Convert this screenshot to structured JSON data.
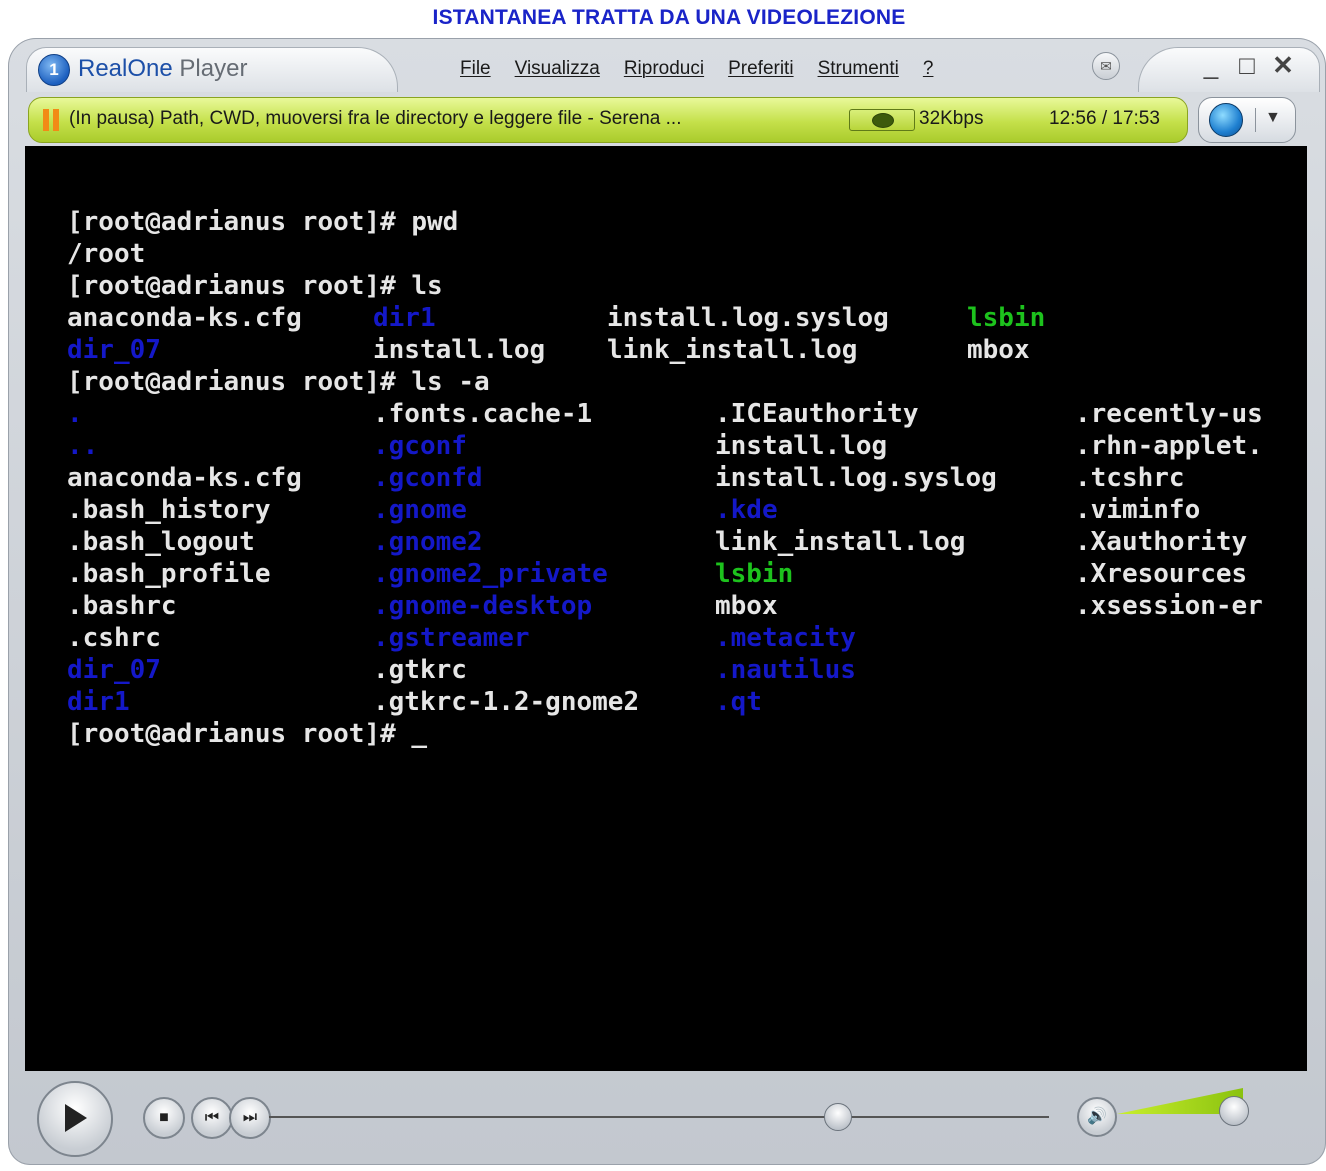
{
  "caption": "ISTANTANEA TRATTA DA UNA VIDEOLEZIONE",
  "app": {
    "logo_glyph": "1",
    "brand_name": "RealOne",
    "brand_suffix": "Player"
  },
  "menu": [
    "File",
    "Visualizza",
    "Riproduci",
    "Preferiti",
    "Strumenti",
    "?"
  ],
  "window_controls": {
    "minimize": "_",
    "maximize": "□",
    "close": "✕"
  },
  "status": {
    "clip_title": "(In pausa) Path, CWD, muoversi fra le directory e leggere file - Serena ...",
    "bitrate": "32Kbps",
    "time": "12:56 / 17:53"
  },
  "terminal": {
    "lines": [
      [
        {
          "t": "[root@adrianus root]# pwd",
          "c": "white",
          "col": 0
        }
      ],
      [
        {
          "t": "/root",
          "c": "white",
          "col": 0
        }
      ],
      [
        {
          "t": "[root@adrianus root]# ls",
          "c": "white",
          "col": 0
        }
      ],
      [
        {
          "t": "anaconda-ks.cfg",
          "c": "white",
          "col": 0
        },
        {
          "t": "dir1",
          "c": "blue",
          "col": 17
        },
        {
          "t": "install.log.syslog",
          "c": "white",
          "col": 30
        },
        {
          "t": "lsbin",
          "c": "green",
          "col": 50
        }
      ],
      [
        {
          "t": "dir_07",
          "c": "blue",
          "col": 0
        },
        {
          "t": "install.log",
          "c": "white",
          "col": 17
        },
        {
          "t": "link_install.log",
          "c": "white",
          "col": 30
        },
        {
          "t": "mbox",
          "c": "white",
          "col": 50
        }
      ],
      [
        {
          "t": "[root@adrianus root]# ls -a",
          "c": "white",
          "col": 0
        }
      ],
      [
        {
          "t": ".",
          "c": "blue",
          "col": 0
        },
        {
          "t": ".fonts.cache-1",
          "c": "white",
          "col": 17
        },
        {
          "t": ".ICEauthority",
          "c": "white",
          "col": 36
        },
        {
          "t": ".recently-us",
          "c": "white",
          "col": 56
        }
      ],
      [
        {
          "t": "..",
          "c": "blue",
          "col": 0
        },
        {
          "t": ".gconf",
          "c": "blue",
          "col": 17
        },
        {
          "t": "install.log",
          "c": "white",
          "col": 36
        },
        {
          "t": ".rhn-applet.",
          "c": "white",
          "col": 56
        }
      ],
      [
        {
          "t": "anaconda-ks.cfg",
          "c": "white",
          "col": 0
        },
        {
          "t": ".gconfd",
          "c": "blue",
          "col": 17
        },
        {
          "t": "install.log.syslog",
          "c": "white",
          "col": 36
        },
        {
          "t": ".tcshrc",
          "c": "white",
          "col": 56
        }
      ],
      [
        {
          "t": ".bash_history",
          "c": "white",
          "col": 0
        },
        {
          "t": ".gnome",
          "c": "blue",
          "col": 17
        },
        {
          "t": ".kde",
          "c": "blue",
          "col": 36
        },
        {
          "t": ".viminfo",
          "c": "white",
          "col": 56
        }
      ],
      [
        {
          "t": ".bash_logout",
          "c": "white",
          "col": 0
        },
        {
          "t": ".gnome2",
          "c": "blue",
          "col": 17
        },
        {
          "t": "link_install.log",
          "c": "white",
          "col": 36
        },
        {
          "t": ".Xauthority",
          "c": "white",
          "col": 56
        }
      ],
      [
        {
          "t": ".bash_profile",
          "c": "white",
          "col": 0
        },
        {
          "t": ".gnome2_private",
          "c": "blue",
          "col": 17
        },
        {
          "t": "lsbin",
          "c": "green",
          "col": 36
        },
        {
          "t": ".Xresources",
          "c": "white",
          "col": 56
        }
      ],
      [
        {
          "t": ".bashrc",
          "c": "white",
          "col": 0
        },
        {
          "t": ".gnome-desktop",
          "c": "blue",
          "col": 17
        },
        {
          "t": "mbox",
          "c": "white",
          "col": 36
        },
        {
          "t": ".xsession-er",
          "c": "white",
          "col": 56
        }
      ],
      [
        {
          "t": ".cshrc",
          "c": "white",
          "col": 0
        },
        {
          "t": ".gstreamer",
          "c": "blue",
          "col": 17
        },
        {
          "t": ".metacity",
          "c": "blue",
          "col": 36
        }
      ],
      [
        {
          "t": "dir_07",
          "c": "blue",
          "col": 0
        },
        {
          "t": ".gtkrc",
          "c": "white",
          "col": 17
        },
        {
          "t": ".nautilus",
          "c": "blue",
          "col": 36
        }
      ],
      [
        {
          "t": "dir1",
          "c": "blue",
          "col": 0
        },
        {
          "t": ".gtkrc-1.2-gnome2",
          "c": "white",
          "col": 17
        },
        {
          "t": ".qt",
          "c": "blue",
          "col": 36
        }
      ],
      [
        {
          "t": "[root@adrianus root]# _",
          "c": "white",
          "col": 0
        }
      ]
    ]
  },
  "playback": {
    "seek_fraction": 0.728,
    "volume_fraction": 0.92
  },
  "colors": {
    "caption": "#1a24c8",
    "status_bar": "#c4e04a",
    "term_blue": "#1418c8",
    "term_green": "#1dc21d",
    "term_white": "#e6e6e6"
  }
}
